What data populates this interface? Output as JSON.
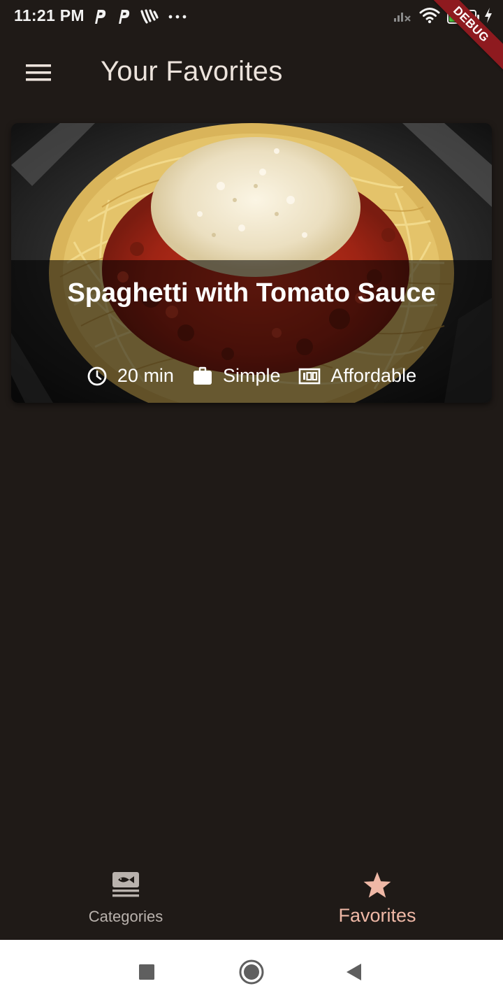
{
  "status_bar": {
    "time": "11:21 PM",
    "left_icons": [
      "p-notification-icon",
      "p-notification-icon",
      "tap-notification-icon",
      "more-dots-icon"
    ],
    "right_icons": [
      "cell-signal-off-icon",
      "wifi-icon",
      "battery-icon",
      "charging-bolt-icon"
    ],
    "battery_level": "70",
    "battery_fraction": 0.7
  },
  "debug_banner": {
    "label": "DEBUG",
    "color": "#8e1a1f"
  },
  "app_bar": {
    "menu_icon": "hamburger-menu-icon",
    "title": "Your Favorites"
  },
  "favorites": [
    {
      "title": "Spaghetti with Tomato Sauce",
      "duration": "20 min",
      "complexity": "Simple",
      "affordability": "Affordable",
      "duration_icon": "clock-icon",
      "complexity_icon": "briefcase-icon",
      "affordability_icon": "money-icon"
    }
  ],
  "bottom_nav": {
    "items": [
      {
        "label": "Categories",
        "icon": "set-meal-icon",
        "selected": false
      },
      {
        "label": "Favorites",
        "icon": "star-icon",
        "selected": true
      }
    ],
    "selected_color": "#efb8a6",
    "unselected_color": "#b9b2ad"
  },
  "system_nav": {
    "buttons": [
      "recents-square-icon",
      "home-circle-icon",
      "back-triangle-icon"
    ]
  },
  "colors": {
    "background": "#1f1a17",
    "title_text": "#ece3dc",
    "accent": "#efb8a6"
  }
}
